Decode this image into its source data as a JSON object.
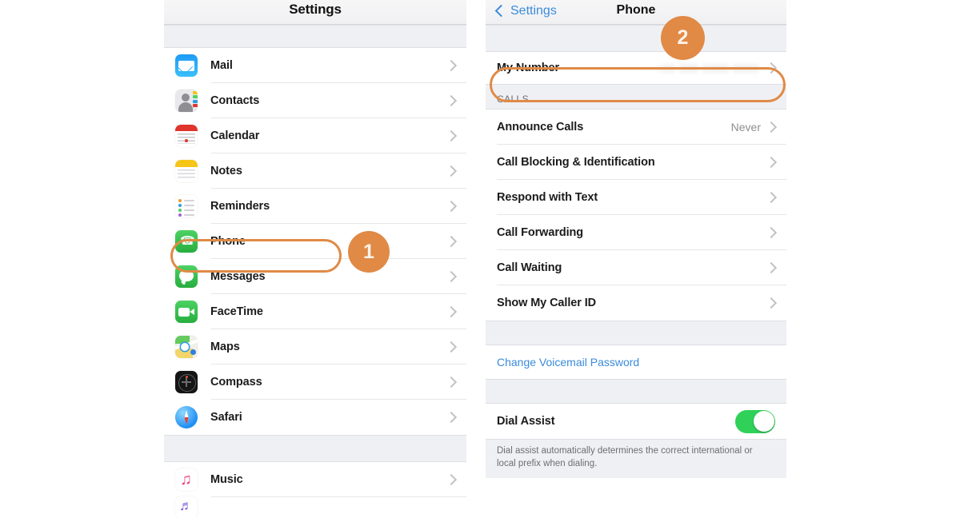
{
  "left_panel": {
    "nav": {
      "title": "Settings"
    },
    "sections": [
      {
        "rows": [
          {
            "label": "Mail",
            "icon": "mail-app-icon"
          },
          {
            "label": "Contacts",
            "icon": "contacts-app-icon"
          },
          {
            "label": "Calendar",
            "icon": "calendar-app-icon"
          },
          {
            "label": "Notes",
            "icon": "notes-app-icon"
          },
          {
            "label": "Reminders",
            "icon": "reminders-app-icon"
          },
          {
            "label": "Phone",
            "icon": "phone-app-icon"
          },
          {
            "label": "Messages",
            "icon": "messages-app-icon"
          },
          {
            "label": "FaceTime",
            "icon": "facetime-app-icon"
          },
          {
            "label": "Maps",
            "icon": "maps-app-icon"
          },
          {
            "label": "Compass",
            "icon": "compass-app-icon"
          },
          {
            "label": "Safari",
            "icon": "safari-app-icon"
          }
        ]
      },
      {
        "rows": [
          {
            "label": "Music",
            "icon": "music-app-icon"
          }
        ]
      }
    ]
  },
  "right_panel": {
    "nav": {
      "back_label": "Settings",
      "title": "Phone"
    },
    "my_number": {
      "label": "My Number",
      "value": ""
    },
    "calls_header": "CALLS",
    "calls_rows": [
      {
        "label": "Announce Calls",
        "value": "Never"
      },
      {
        "label": "Call Blocking & Identification",
        "value": ""
      },
      {
        "label": "Respond with Text",
        "value": ""
      },
      {
        "label": "Call Forwarding",
        "value": ""
      },
      {
        "label": "Call Waiting",
        "value": ""
      },
      {
        "label": "Show My Caller ID",
        "value": ""
      }
    ],
    "voicemail_link": "Change Voicemail Password",
    "dial_assist": {
      "label": "Dial Assist",
      "state": "on"
    },
    "dial_assist_note": "Dial assist automatically determines the correct international or local prefix when dialing."
  },
  "annotations": {
    "badge_one": "1",
    "badge_two": "2",
    "accent_color": "#e08a46"
  }
}
